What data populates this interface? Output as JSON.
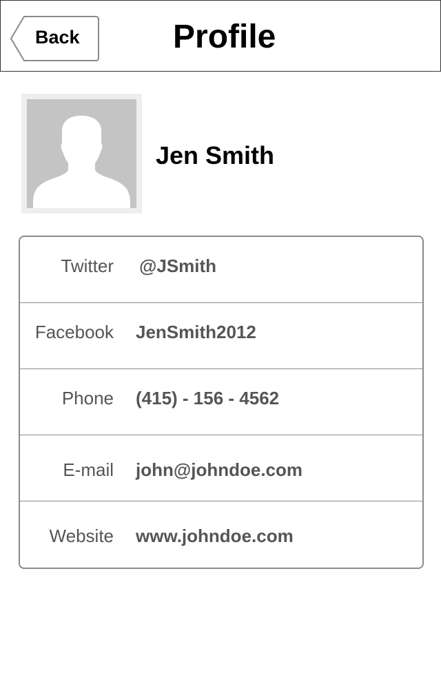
{
  "nav": {
    "back_label": "Back",
    "title": "Profile"
  },
  "profile": {
    "name": "Jen Smith",
    "avatar_icon": "person-silhouette-icon"
  },
  "fields": [
    {
      "label": "Twitter",
      "value": "@JSmith"
    },
    {
      "label": "Facebook",
      "value": "JenSmith2012"
    },
    {
      "label": "Phone",
      "value": "(415) - 156 - 4562"
    },
    {
      "label": "E-mail",
      "value": "john@johndoe.com"
    },
    {
      "label": "Website",
      "value": "www.johndoe.com"
    }
  ],
  "colors": {
    "border": "#8a8a8a",
    "text_muted": "#555555",
    "avatar_bg": "#c4c4c4",
    "avatar_frame": "#eeeeee"
  }
}
